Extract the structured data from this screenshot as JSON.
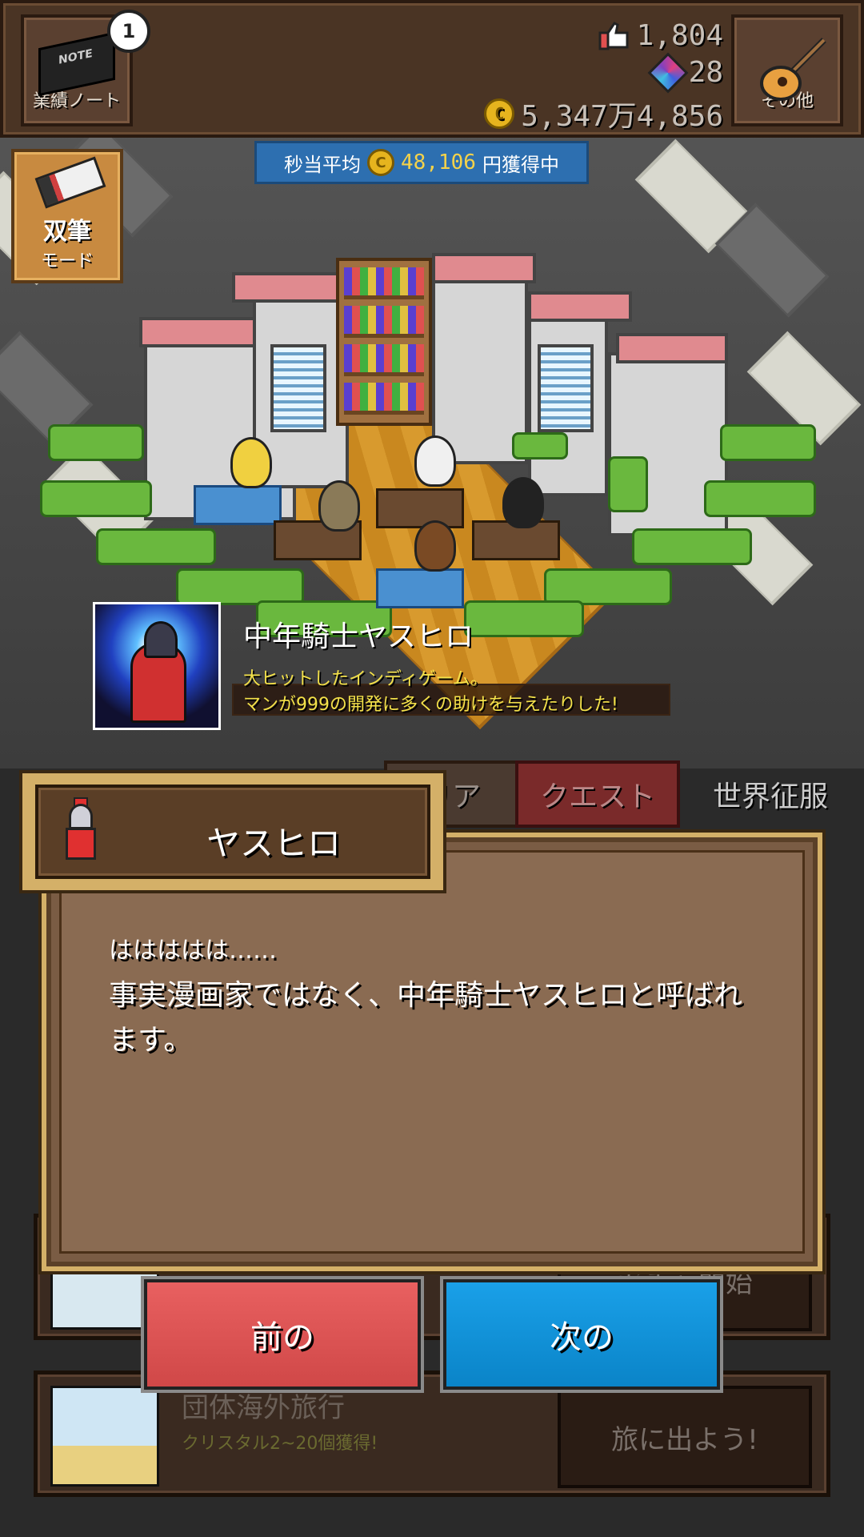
{
  "topbar": {
    "notebook_label": "業績ノート",
    "notification_count": "1",
    "likes": "1,804",
    "gems": "28",
    "coins": "5,347万4,856",
    "other_label": "その他"
  },
  "rate": {
    "prefix": "秒当平均",
    "value": "48,106",
    "suffix": "円獲得中"
  },
  "dual_brush": {
    "line1": "双筆",
    "line2": "モード"
  },
  "achievement": {
    "title": "中年騎士ヤスヒロ",
    "desc_line1": "大ヒットしたインディゲーム。",
    "desc_line2": "マンが999の開発に多くの助けを与えたりした!"
  },
  "tabs": {
    "career": "リア",
    "quest": "クエスト",
    "world": "世界征服"
  },
  "list": {
    "item1_button": "ガチャ開始",
    "item2_title": "団体海外旅行",
    "item2_sub": "クリスタル2~20個獲得!",
    "item2_button": "旅に出よう!"
  },
  "dialog": {
    "speaker": "ヤスヒロ",
    "line1": "ははははは……",
    "line2": "事実漫画家ではなく、中年騎士ヤスヒロと呼ばれ",
    "line3": "ます。"
  },
  "buttons": {
    "prev": "前の",
    "next": "次の"
  },
  "colors": {
    "prev_button": "#d04848",
    "next_button": "#0a84c8",
    "accent_gold": "#d4b068"
  }
}
